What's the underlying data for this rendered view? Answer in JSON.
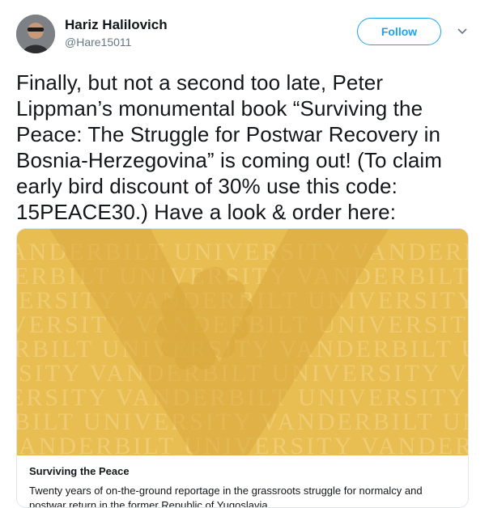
{
  "user": {
    "name": "Hariz Halilovich",
    "handle": "@Hare15011"
  },
  "follow_label": "Follow",
  "icons": {
    "avatar": "avatar-photo",
    "caret": "chevron-down-icon",
    "card_logo": "oak-leaf-v-logo"
  },
  "tweet": {
    "text": "Finally, but not a second too late, Peter Lippman’s monumental book “Surviving the Peace: The Struggle for Postwar Recovery in Bosnia-Herzegovina” is coming out! (To claim early bird discount of 30% use this code: 15PEACE30.) Have a look & order here:"
  },
  "card": {
    "watermark_lines": [
      "ANDERBILT UNIVERSITY VANDERBILT UNIVERSITY",
      "ERBILT UNIVERSITY VANDERBILT UNIVERSITY VANDE",
      "ERSITY VANDERBILT UNIVERSITY VANDERBILT",
      "VERSITY VANDERBILT UNIVERSITY VANDERBILT",
      "RBILT UNIVERSITY VANDERBILT UNIVERSITY",
      "SITY VANDERBILT UNIVERSITY VANDERBILT",
      "ERSITY VANDERBILT UNIVERSITY VANDERBILT",
      "BILT UNIVERSITY VANDERBILT UNIVERSITY",
      "ANDERBILT UNIVERSITY VANDERBILT UNIVERSITY"
    ],
    "title": "Surviving the Peace",
    "description": "Twenty years of on-the-ground reportage in the grassroots struggle for normalcy and postwar return in the former Republic of Yugoslavia."
  },
  "colors": {
    "accent": "#1da1f2",
    "card_gold": "#e8bd52",
    "text": "#14171a",
    "muted": "#657786"
  }
}
